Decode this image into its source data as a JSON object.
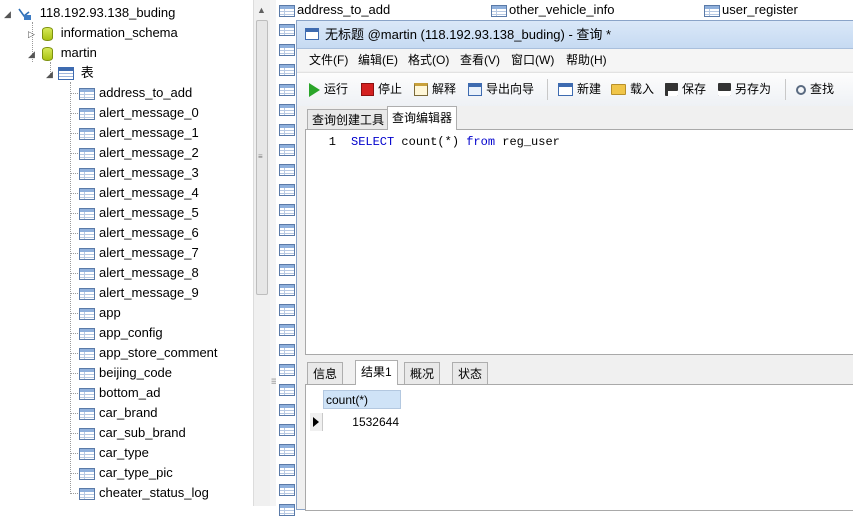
{
  "navigator": {
    "connection": "118.192.93.138_buding",
    "databases": [
      "information_schema",
      "martin"
    ],
    "tables_folder": "表",
    "tables": [
      "address_to_add",
      "alert_message_0",
      "alert_message_1",
      "alert_message_2",
      "alert_message_3",
      "alert_message_4",
      "alert_message_5",
      "alert_message_6",
      "alert_message_7",
      "alert_message_8",
      "alert_message_9",
      "app",
      "app_config",
      "app_store_comment",
      "beijing_code",
      "bottom_ad",
      "car_brand",
      "car_sub_brand",
      "car_type",
      "car_type_pic",
      "cheater_status_log"
    ]
  },
  "object_list": {
    "visible_headers": [
      "address_to_add",
      "other_vehicle_info",
      "user_register"
    ]
  },
  "query_window": {
    "title": "无标题 @martin (118.192.93.138_buding) - 查询 *",
    "menu": [
      "文件(F)",
      "编辑(E)",
      "格式(O)",
      "查看(V)",
      "窗口(W)",
      "帮助(H)"
    ],
    "toolbar": {
      "run": "运行",
      "stop": "停止",
      "explain": "解释",
      "export_wizard": "导出向导",
      "new": "新建",
      "load": "载入",
      "save": "保存",
      "save_as": "另存为",
      "find": "查找"
    },
    "tabs": [
      "查询创建工具",
      "查询编辑器"
    ],
    "active_tab": "查询编辑器",
    "editor": {
      "line_number": "1",
      "sql_keyword_select": "SELECT",
      "sql_expr": " count(*) ",
      "sql_keyword_from": "from",
      "sql_table": " reg_user"
    },
    "result_tabs": [
      "信息",
      "结果1",
      "概况",
      "状态"
    ],
    "active_result_tab": "结果1",
    "result": {
      "column": "count(*)",
      "value": "1532644"
    }
  },
  "colors": {
    "title_bar": "#c6daf2",
    "sql_keyword": "#0000cc",
    "result_header": "#cfe3f7"
  }
}
